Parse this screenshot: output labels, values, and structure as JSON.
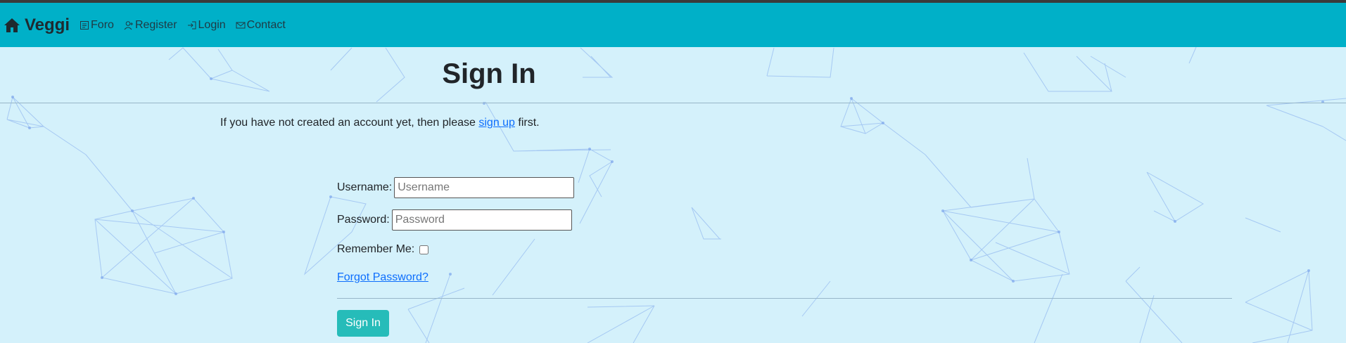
{
  "navbar": {
    "brand": "Veggi",
    "links": [
      {
        "label": "Foro",
        "icon": "forum-icon"
      },
      {
        "label": "Register",
        "icon": "user-add-icon"
      },
      {
        "label": "Login",
        "icon": "login-icon"
      },
      {
        "label": "Contact",
        "icon": "mail-icon"
      }
    ]
  },
  "main": {
    "title": "Sign In",
    "intro_before": "If you have not created an account yet, then please ",
    "intro_link": "sign up",
    "intro_after": " first.",
    "username_label": "Username:",
    "username_placeholder": "Username",
    "password_label": "Password:",
    "password_placeholder": "Password",
    "remember_label": "Remember Me:",
    "forgot_link": "Forgot Password?",
    "submit_label": "Sign In"
  },
  "colors": {
    "navbar": "#00b0c8",
    "background": "#d4f1fb",
    "button": "#26bcb9",
    "link": "#0d6efd"
  }
}
